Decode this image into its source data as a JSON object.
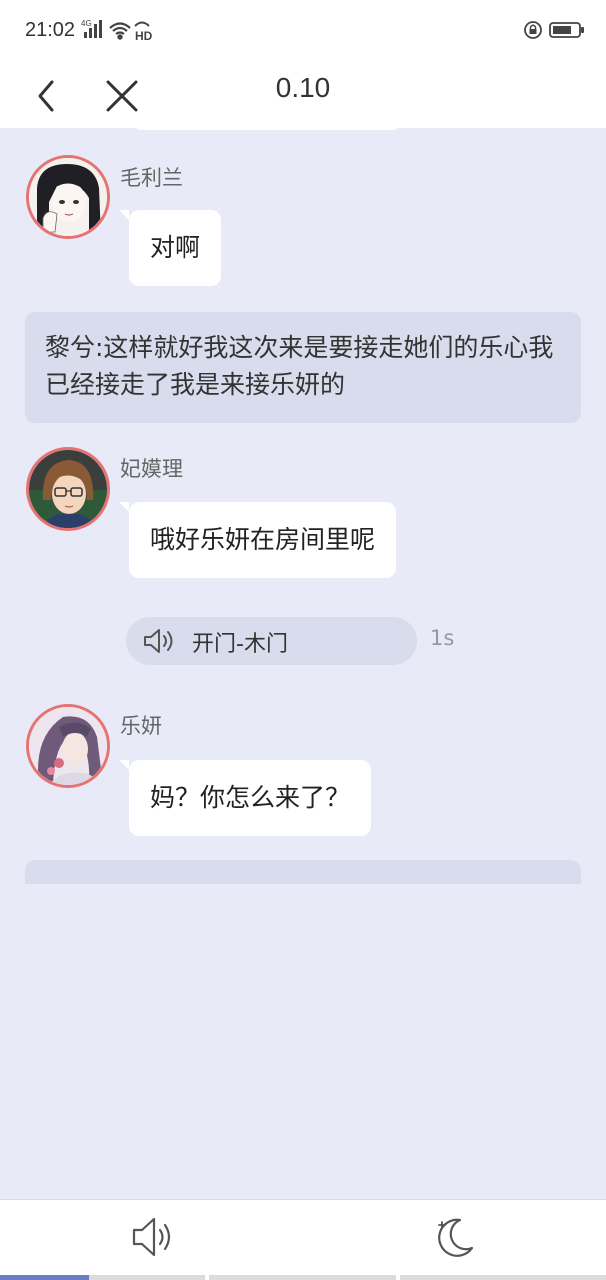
{
  "status_bar": {
    "time": "21:02",
    "network_label": "4G",
    "hd_label": "HD",
    "icons": [
      "signal-icon",
      "wifi-icon",
      "hd-icon",
      "lock-rotation-icon",
      "battery-icon"
    ]
  },
  "nav": {
    "title": "0.10",
    "back_icon": "chevron-left-icon",
    "close_icon": "close-icon"
  },
  "messages": [
    {
      "type": "character",
      "speaker": "毛利兰",
      "text": "对啊"
    },
    {
      "type": "narration",
      "text": "黎兮:这样就好我这次来是要接走她们的乐心我已经接走了我是来接乐妍的"
    },
    {
      "type": "character",
      "speaker": "妃嫫理",
      "text": "哦好乐妍在房间里呢"
    },
    {
      "type": "voice",
      "label": "开门-木门",
      "duration": "1s"
    },
    {
      "type": "character",
      "speaker": "乐妍",
      "text": "妈？你怎么来了？"
    }
  ],
  "bottom_bar": {
    "sound_icon": "speaker-icon",
    "night_icon": "moon-icon",
    "progress": 0.147
  },
  "colors": {
    "background": "#e8eaf7",
    "bubble": "#ffffff",
    "narration": "#d9dcec",
    "avatar_border": "#e57373",
    "progress_fill": "#6c7fc4"
  }
}
